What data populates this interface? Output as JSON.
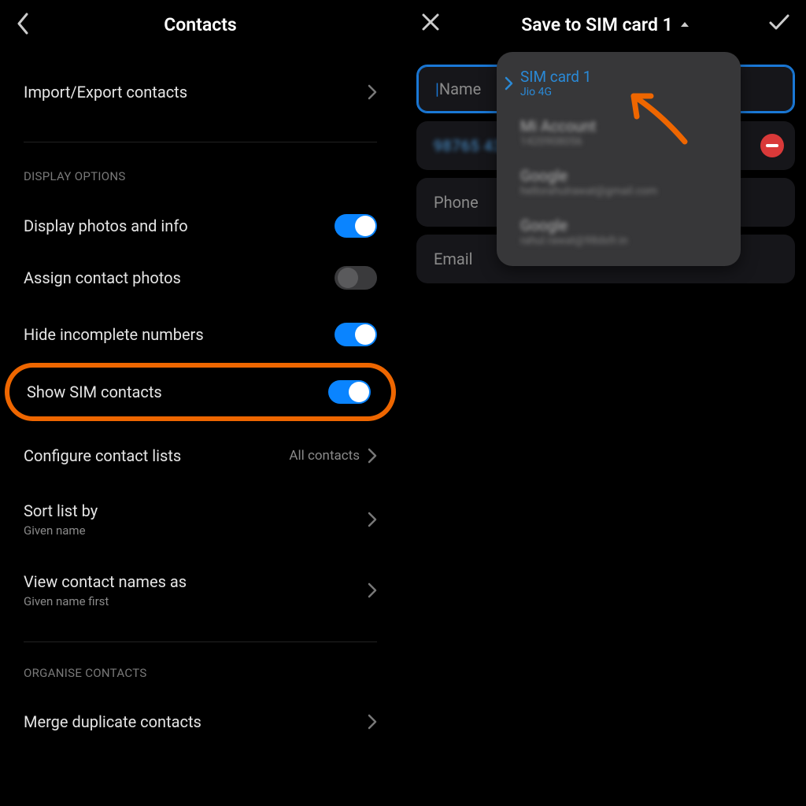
{
  "colors": {
    "accent": "#0a84ff",
    "annotation": "#ee6600",
    "dropdown_accent": "#2a89d6"
  },
  "left": {
    "title": "Contacts",
    "import_export": "Import/Export contacts",
    "section_display": "DISPLAY OPTIONS",
    "items": {
      "display_photos": {
        "label": "Display photos and info",
        "on": true
      },
      "assign_photos": {
        "label": "Assign contact photos",
        "on": false
      },
      "hide_incomplete": {
        "label": "Hide incomplete numbers",
        "on": true
      },
      "show_sim": {
        "label": "Show SIM contacts",
        "on": true
      },
      "configure": {
        "label": "Configure contact lists",
        "trail": "All contacts"
      },
      "sort": {
        "label": "Sort list by",
        "sub": "Given name"
      },
      "view_as": {
        "label": "View contact names as",
        "sub": "Given name first"
      }
    },
    "section_organise": "ORGANISE CONTACTS",
    "merge": "Merge duplicate contacts"
  },
  "right": {
    "title": "Save to SIM card 1",
    "fields": {
      "name": {
        "placeholder": "Name"
      },
      "number": {
        "value": "98765 43"
      },
      "phone": {
        "placeholder": "Phone"
      },
      "email": {
        "placeholder": "Email"
      }
    },
    "dropdown": [
      {
        "title": "SIM card 1",
        "sub": "Jio 4G",
        "selected": true
      },
      {
        "title": "Mi Account",
        "sub": "1420908056"
      },
      {
        "title": "Google",
        "sub": "hellorahulrawat@gmail.com"
      },
      {
        "title": "Google",
        "sub": "rahul.rawat@98dsfr.in"
      }
    ]
  }
}
